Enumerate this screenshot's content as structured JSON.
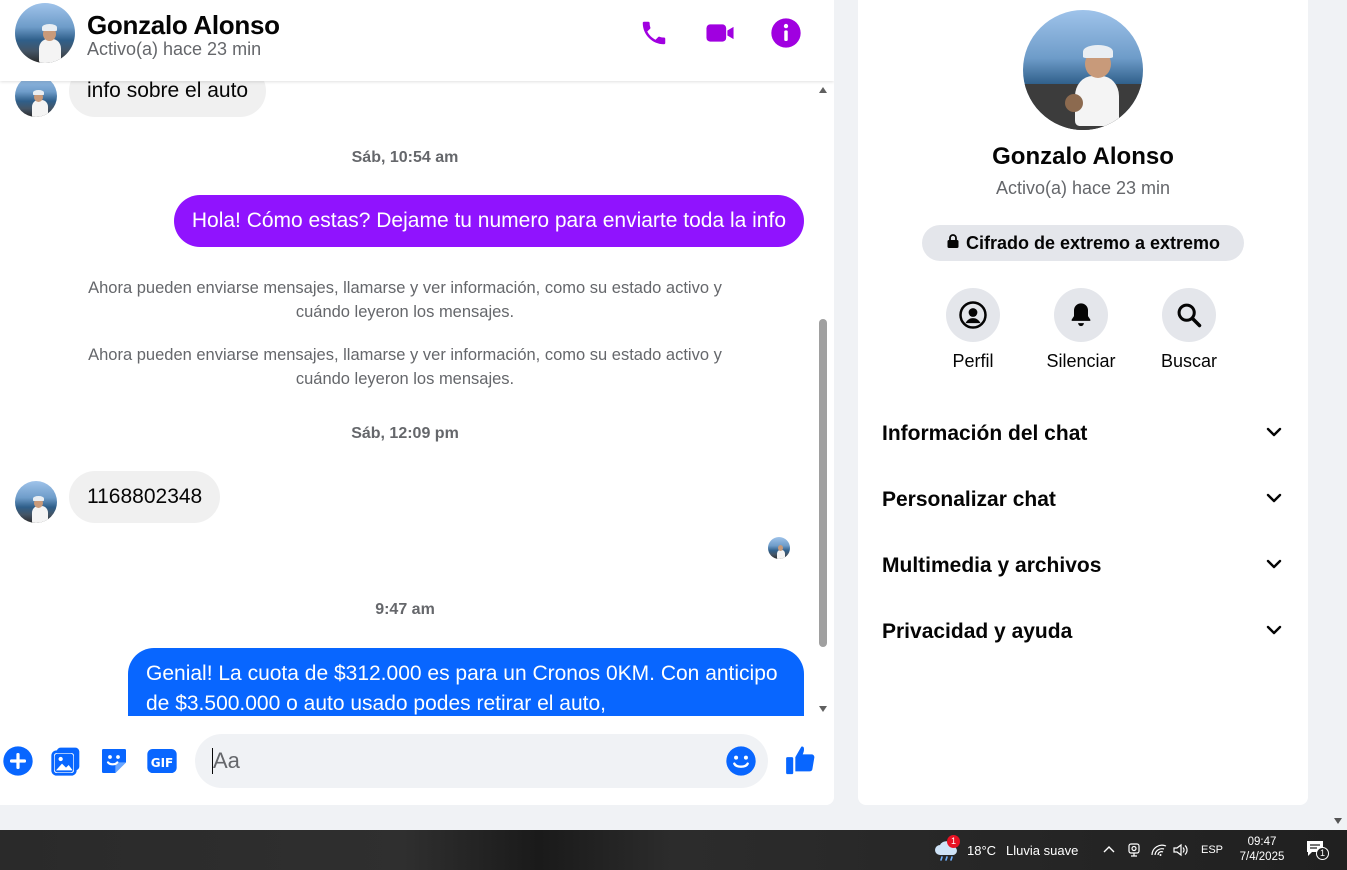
{
  "contact": {
    "name": "Gonzalo Alonso",
    "status": "Activo(a) hace 23 min"
  },
  "header": {
    "icons": [
      "phone-icon",
      "video-camera-icon",
      "info-icon"
    ],
    "accent_color": "#a000e0"
  },
  "messages": {
    "incoming_1": "info sobre el auto",
    "timestamp_1": "Sáb, 10:54 am",
    "outgoing_1": "Hola! Cómo estas? Dejame tu numero para enviarte toda la info",
    "system_note_1": "Ahora pueden enviarse mensajes, llamarse y ver información, como su estado activo y cuándo leyeron los mensajes.",
    "system_note_2": "Ahora pueden enviarse mensajes, llamarse y ver información, como su estado activo y cuándo leyeron los mensajes.",
    "timestamp_2": "Sáb, 12:09 pm",
    "incoming_2": "1168802348",
    "timestamp_3": "9:47 am",
    "outgoing_2": "Genial! La cuota de $312.000 es para un Cronos 0KM. Con anticipo de $3.500.000 o auto usado podes retirar el auto,"
  },
  "composer": {
    "placeholder": "Aa",
    "icons": [
      "plus-icon",
      "photo-icon",
      "sticker-icon",
      "gif-icon",
      "emoji-icon",
      "thumbs-up-icon"
    ]
  },
  "info_panel": {
    "encryption_label": "Cifrado de extremo a extremo",
    "actions": [
      {
        "label": "Perfil",
        "icon": "profile-icon"
      },
      {
        "label": "Silenciar",
        "icon": "bell-icon"
      },
      {
        "label": "Buscar",
        "icon": "search-icon"
      }
    ],
    "sections": [
      "Información del chat",
      "Personalizar chat",
      "Multimedia y archivos",
      "Privacidad y ayuda"
    ]
  },
  "taskbar": {
    "weather_badge": "1",
    "temperature": "18°C",
    "weather_text": "Lluvia suave",
    "language": "ESP",
    "time": "09:47",
    "date": "7/4/2025",
    "notification_count": "1"
  },
  "colors": {
    "purple_bubble": "#9013fe",
    "blue_bubble": "#0866ff",
    "accent_blue": "#0866ff",
    "incoming_bubble": "#f0f0f0"
  }
}
